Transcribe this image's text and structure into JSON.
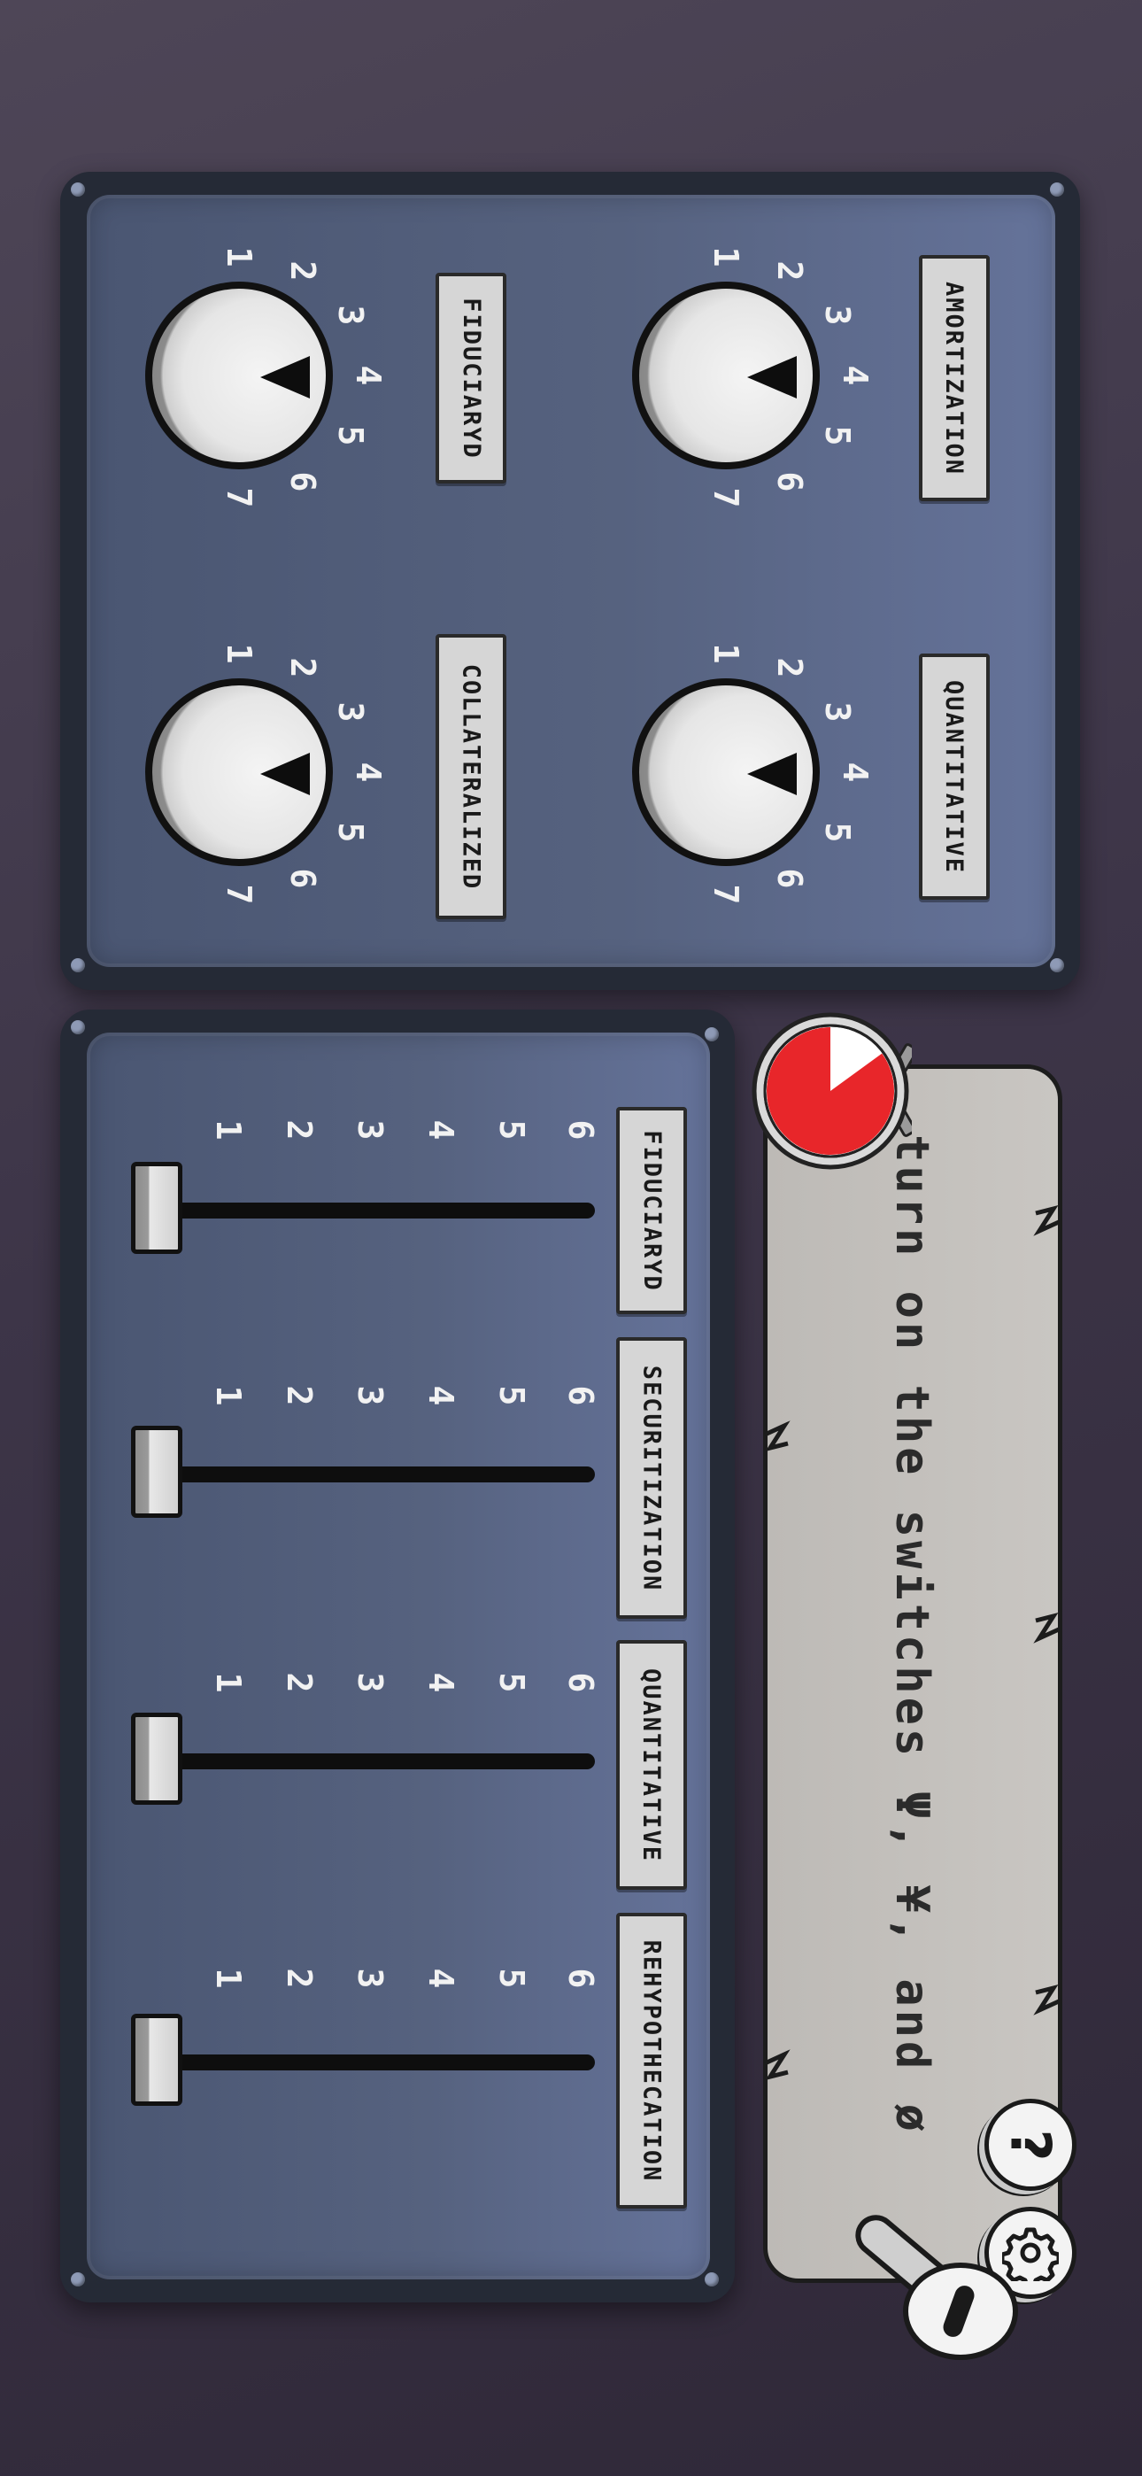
{
  "knob_panel": {
    "knobs": [
      {
        "label": "AMORTIZATION",
        "numbers": [
          "1",
          "2",
          "3",
          "4",
          "5",
          "6",
          "7"
        ],
        "value": 4
      },
      {
        "label": "QUANTITATIVE",
        "numbers": [
          "1",
          "2",
          "3",
          "4",
          "5",
          "6",
          "7"
        ],
        "value": 4
      },
      {
        "label": "FIDUCIARYD",
        "numbers": [
          "1",
          "2",
          "3",
          "4",
          "5",
          "6",
          "7"
        ],
        "value": 4
      },
      {
        "label": "COLLATERALIZED",
        "numbers": [
          "1",
          "2",
          "3",
          "4",
          "5",
          "6",
          "7"
        ],
        "value": 4
      }
    ]
  },
  "slider_panel": {
    "sliders": [
      {
        "label": "FIDUCIARYD",
        "numbers": [
          "1",
          "2",
          "3",
          "4",
          "5",
          "6"
        ],
        "value": 1
      },
      {
        "label": "SECURITIZATION",
        "numbers": [
          "1",
          "2",
          "3",
          "4",
          "5",
          "6"
        ],
        "value": 1
      },
      {
        "label": "QUANTITATIVE",
        "numbers": [
          "1",
          "2",
          "3",
          "4",
          "5",
          "6"
        ],
        "value": 1
      },
      {
        "label": "REHYPOTHECATION",
        "numbers": [
          "1",
          "2",
          "3",
          "4",
          "5",
          "6"
        ],
        "value": 1
      }
    ]
  },
  "instruction": {
    "text": "turn on the switches Ψ, ¥, and ø"
  },
  "timer": {
    "remaining_fraction": 0.85,
    "color": "#e8262a",
    "icon": "stopwatch-icon"
  },
  "buttons": {
    "help_label": "?",
    "settings_icon": "gear-icon",
    "lever_icon": "lever-icon"
  },
  "colors": {
    "panel_bg": "#56627f",
    "panel_frame": "#252a36",
    "strip_bg": "#c4c1bd",
    "timer_red": "#e8262a"
  }
}
